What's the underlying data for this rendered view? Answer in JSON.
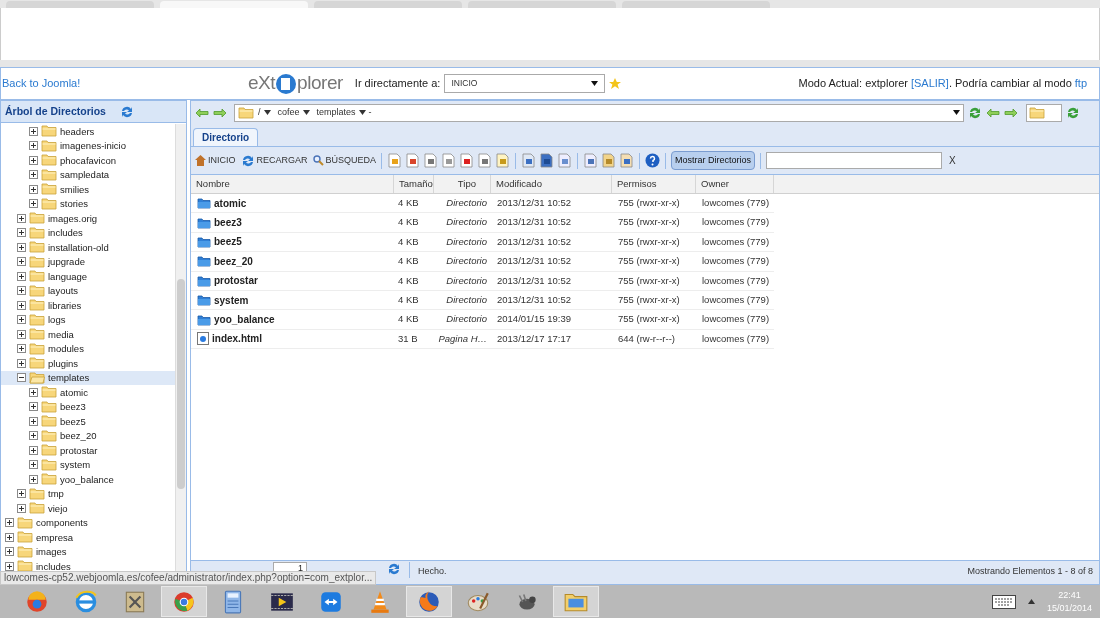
{
  "browser_tabs": [
    {
      "selected": false
    },
    {
      "selected": true
    },
    {
      "selected": false
    },
    {
      "selected": false
    },
    {
      "selected": false
    }
  ],
  "header": {
    "back_link": "Back to Joomla!",
    "logo_left": "eXt",
    "logo_right": "plorer",
    "goto_label": "Ir directamente a:",
    "goto_value": "INICIO",
    "mode_text": "Modo Actual: extplorer",
    "logout_link": "[SALIR]",
    "mode_suffix": ". Podría cambiar al modo",
    "ftp_link": "ftp"
  },
  "sidebar": {
    "title": "Árbol de Directorios",
    "tree": [
      {
        "children": [
          {
            "children": [
              {
                "label": "headers",
                "expanded": false,
                "selected": false
              },
              {
                "label": "imagenes-inicio",
                "expanded": false,
                "selected": false
              },
              {
                "label": "phocafavicon",
                "expanded": false,
                "selected": false
              },
              {
                "label": "sampledata",
                "expanded": false,
                "selected": false
              },
              {
                "label": "smilies",
                "expanded": false,
                "selected": false
              },
              {
                "label": "stories",
                "expanded": false,
                "selected": false
              }
            ]
          },
          {
            "label": "images.orig",
            "expanded": false,
            "selected": false
          },
          {
            "label": "includes",
            "expanded": false,
            "selected": false
          },
          {
            "label": "installation-old",
            "expanded": false,
            "selected": false
          },
          {
            "label": "jupgrade",
            "expanded": false,
            "selected": false
          },
          {
            "label": "language",
            "expanded": false,
            "selected": false
          },
          {
            "label": "layouts",
            "expanded": false,
            "selected": false
          },
          {
            "label": "libraries",
            "expanded": false,
            "selected": false
          },
          {
            "label": "logs",
            "expanded": false,
            "selected": false
          },
          {
            "label": "media",
            "expanded": false,
            "selected": false
          },
          {
            "label": "modules",
            "expanded": false,
            "selected": false
          },
          {
            "label": "plugins",
            "expanded": false,
            "selected": false
          },
          {
            "label": "templates",
            "expanded": true,
            "selected": true,
            "children": [
              {
                "label": "atomic",
                "expanded": false,
                "selected": false
              },
              {
                "label": "beez3",
                "expanded": false,
                "selected": false
              },
              {
                "label": "beez5",
                "expanded": false,
                "selected": false
              },
              {
                "label": "beez_20",
                "expanded": false,
                "selected": false
              },
              {
                "label": "protostar",
                "expanded": false,
                "selected": false
              },
              {
                "label": "system",
                "expanded": false,
                "selected": false
              },
              {
                "label": "yoo_balance",
                "expanded": false,
                "selected": false
              }
            ]
          },
          {
            "label": "tmp",
            "expanded": false,
            "selected": false
          },
          {
            "label": "viejo",
            "expanded": false,
            "selected": false
          }
        ]
      },
      {
        "label": "components",
        "expanded": false,
        "selected": false
      },
      {
        "label": "empresa",
        "expanded": false,
        "selected": false
      },
      {
        "label": "images",
        "expanded": false,
        "selected": false
      },
      {
        "label": "includes",
        "expanded": false,
        "selected": false
      }
    ]
  },
  "address": {
    "root": "/",
    "segments": [
      "cofee",
      "templates"
    ],
    "tail": "-"
  },
  "tabs": [
    {
      "label": "Directorio",
      "selected": true
    }
  ],
  "toolbar": {
    "home": "INICIO",
    "reload": "RECARGAR",
    "search": "BÚSQUEDA",
    "show_dirs": {
      "label": "Mostrar Directorios",
      "selected": true
    },
    "clear": "X"
  },
  "table": {
    "columns": [
      "Nombre",
      "Tamaño",
      "Tipo",
      "Modificado",
      "Permisos",
      "Owner"
    ],
    "rows": [
      {
        "kind": "folder",
        "name": "atomic",
        "size": "4 KB",
        "type": "Directorio",
        "modified": "2013/12/31 10:52",
        "perms": "755 (rwxr-xr-x)",
        "owner": "lowcomes (779)"
      },
      {
        "kind": "folder",
        "name": "beez3",
        "size": "4 KB",
        "type": "Directorio",
        "modified": "2013/12/31 10:52",
        "perms": "755 (rwxr-xr-x)",
        "owner": "lowcomes (779)"
      },
      {
        "kind": "folder",
        "name": "beez5",
        "size": "4 KB",
        "type": "Directorio",
        "modified": "2013/12/31 10:52",
        "perms": "755 (rwxr-xr-x)",
        "owner": "lowcomes (779)"
      },
      {
        "kind": "folder",
        "name": "beez_20",
        "size": "4 KB",
        "type": "Directorio",
        "modified": "2013/12/31 10:52",
        "perms": "755 (rwxr-xr-x)",
        "owner": "lowcomes (779)"
      },
      {
        "kind": "folder",
        "name": "protostar",
        "size": "4 KB",
        "type": "Directorio",
        "modified": "2013/12/31 10:52",
        "perms": "755 (rwxr-xr-x)",
        "owner": "lowcomes (779)"
      },
      {
        "kind": "folder",
        "name": "system",
        "size": "4 KB",
        "type": "Directorio",
        "modified": "2013/12/31 10:52",
        "perms": "755 (rwxr-xr-x)",
        "owner": "lowcomes (779)"
      },
      {
        "kind": "folder",
        "name": "yoo_balance",
        "size": "4 KB",
        "type": "Directorio",
        "modified": "2014/01/15 19:39",
        "perms": "755 (rwxr-xr-x)",
        "owner": "lowcomes (779)"
      },
      {
        "kind": "file",
        "name": "index.html",
        "size": "31 B",
        "type": "Pagina H…",
        "modified": "2013/12/17 17:17",
        "perms": "644 (rw-r--r--)",
        "owner": "lowcomes (779)"
      }
    ]
  },
  "pagination": {
    "page": "1",
    "status": "Hecho.",
    "summary": "Mostrando Elementos 1 - 8 of 8"
  },
  "status_url": "lowcomes-cp52.webjoomla.es/cofee/administrator/index.php?option=com_extplor...",
  "taskbar": {
    "buttons": [
      {
        "open": false
      },
      {
        "open": false
      },
      {
        "open": false
      },
      {
        "open": true
      },
      {
        "open": false
      },
      {
        "open": false
      },
      {
        "open": false
      },
      {
        "open": false
      },
      {
        "open": true
      },
      {
        "open": false
      },
      {
        "open": false
      },
      {
        "open": true
      }
    ],
    "time": "22:41",
    "date": "15/01/2014"
  }
}
